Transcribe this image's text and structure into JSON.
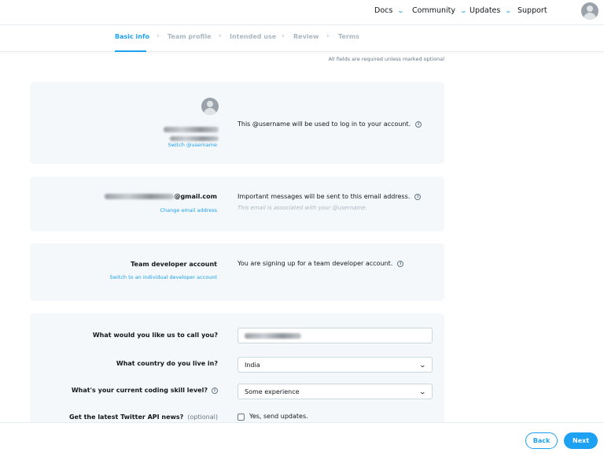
{
  "nav": {
    "items": [
      {
        "label": "Docs",
        "has_dropdown": true
      },
      {
        "label": "Community",
        "has_dropdown": true
      },
      {
        "label": "Updates",
        "has_dropdown": true
      },
      {
        "label": "Support",
        "has_dropdown": false
      }
    ],
    "avatar_icon": "user-avatar-icon"
  },
  "steps": {
    "items": [
      "Basic info",
      "Team profile",
      "Intended use",
      "Review",
      "Terms"
    ],
    "active": "Basic info",
    "separator": "›"
  },
  "required_note": "All fields are required unless marked optional",
  "username_card": {
    "username_blurred": "[redacted]",
    "handle_blurred": "[redacted]",
    "switch_link": "Switch @username",
    "description": "This @username will be used to log in to your account.",
    "info_icon": "info-icon"
  },
  "email_card": {
    "email_suffix": "@gmail.com",
    "change_link": "Change email address",
    "description": "Important messages will be sent to this email address.",
    "subdescription": "This email is associated with your @username."
  },
  "account_card": {
    "label": "Team developer account",
    "switch_link": "Switch to an individual developer account",
    "description": "You are signing up for a team developer account."
  },
  "form": {
    "name_label": "What would you like us to call you?",
    "name_value_blurred": "[redacted]",
    "country_label": "What country do you live in?",
    "country_value": "India",
    "skill_label": "What's your current coding skill level?",
    "skill_value": "Some experience",
    "news_label": "Get the latest Twitter API news?",
    "news_optional": "(optional)",
    "news_checkbox_label": "Yes, send updates.",
    "news_checked": false
  },
  "footer": {
    "back_label": "Back",
    "next_label": "Next"
  },
  "colors": {
    "accent": "#1da1f2",
    "card_bg": "#f5f8fa",
    "muted": "#aab8c2"
  }
}
